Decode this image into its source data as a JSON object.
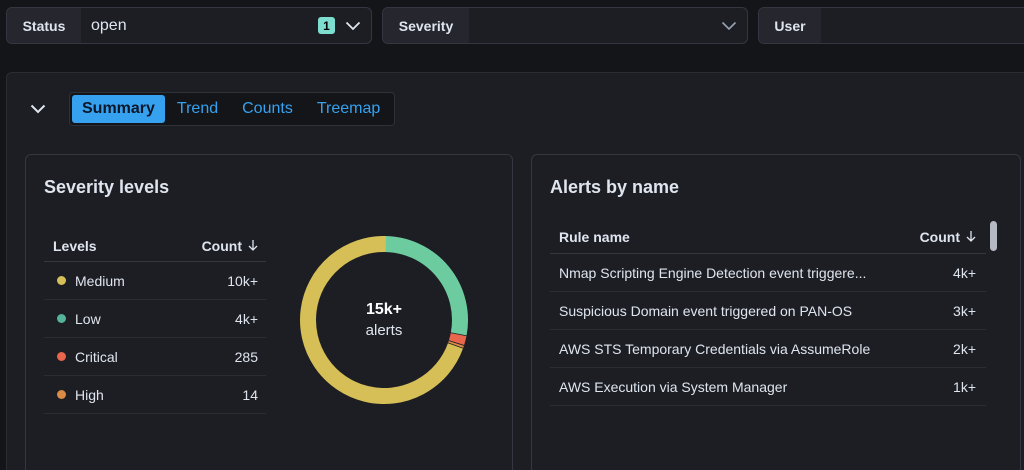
{
  "filters": [
    {
      "label": "Status",
      "value": "open",
      "count": "1"
    },
    {
      "label": "Severity",
      "value": ""
    },
    {
      "label": "User",
      "value": ""
    }
  ],
  "tabs": [
    {
      "label": "Summary",
      "active": true
    },
    {
      "label": "Trend",
      "active": false
    },
    {
      "label": "Counts",
      "active": false
    },
    {
      "label": "Treemap",
      "active": false
    }
  ],
  "severity_card": {
    "title": "Severity levels",
    "columns": {
      "levels": "Levels",
      "count": "Count"
    },
    "rows": [
      {
        "level": "Medium",
        "count": "10k+",
        "color": "#d6bf57"
      },
      {
        "level": "Low",
        "count": "4k+",
        "color": "#54b399"
      },
      {
        "level": "Critical",
        "count": "285",
        "color": "#e7664c"
      },
      {
        "level": "High",
        "count": "14",
        "color": "#da8b45"
      }
    ],
    "donut": {
      "total": "15k+",
      "unit": "alerts",
      "segments": [
        {
          "name": "Low",
          "value": 4200,
          "color": "#6dcc9f"
        },
        {
          "name": "Critical",
          "value": 285,
          "color": "#e7664c"
        },
        {
          "name": "High",
          "value": 14,
          "color": "#da8b45"
        },
        {
          "name": "Medium",
          "value": 10500,
          "color": "#d6bf57"
        }
      ]
    }
  },
  "alerts_card": {
    "title": "Alerts by name",
    "columns": {
      "rule": "Rule name",
      "count": "Count"
    },
    "rows": [
      {
        "rule": "Nmap Scripting Engine Detection event triggere...",
        "count": "4k+"
      },
      {
        "rule": "Suspicious Domain event triggered on PAN-OS",
        "count": "3k+"
      },
      {
        "rule": "AWS STS Temporary Credentials via AssumeRole",
        "count": "2k+"
      },
      {
        "rule": "AWS Execution via System Manager",
        "count": "1k+"
      }
    ]
  }
}
